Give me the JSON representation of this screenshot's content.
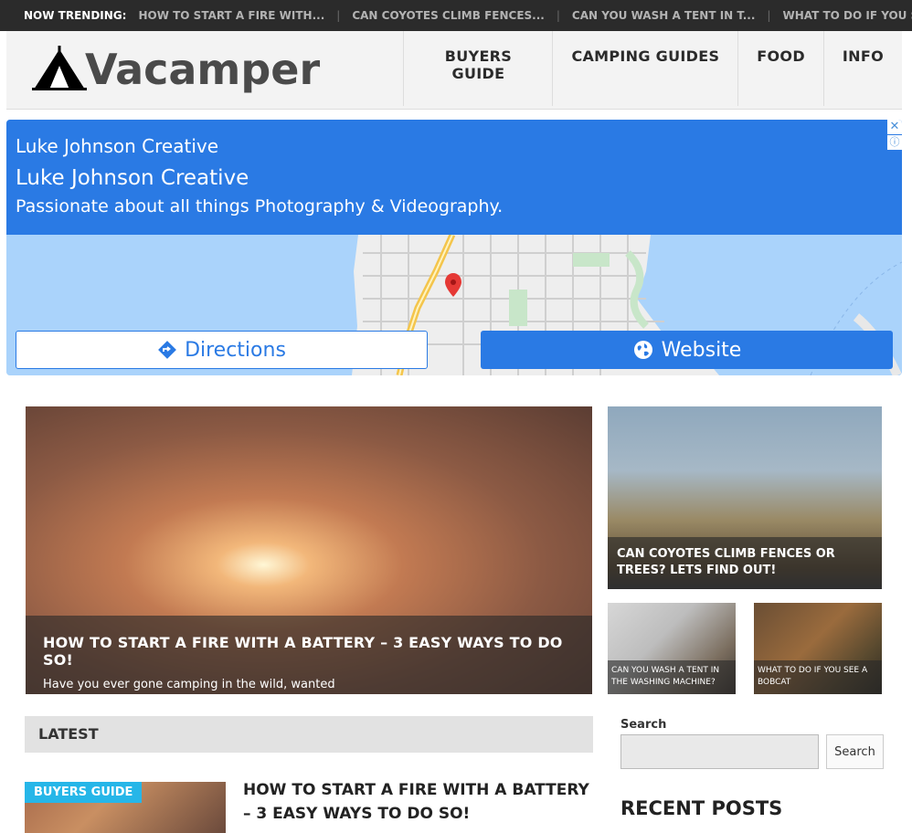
{
  "trending": {
    "label": "NOW TRENDING:",
    "items": [
      "HOW TO START A FIRE WITH...",
      "CAN COYOTES CLIMB FENCES...",
      "CAN YOU WASH A TENT IN T...",
      "WHAT TO DO IF YOU SEE A ..."
    ]
  },
  "site": {
    "logo_text": "Vacamper"
  },
  "nav": {
    "items": [
      "BUYERS GUIDE",
      "CAMPING GUIDES",
      "FOOD",
      "INFO"
    ]
  },
  "ad": {
    "line1": "Luke Johnson Creative",
    "line2": "Luke Johnson Creative",
    "line3": "Passionate about all things Photography & Videography.",
    "close": "✕",
    "info": "ⓘ",
    "directions_label": "Directions",
    "website_label": "Website"
  },
  "featured": {
    "main_title": "HOW TO START A FIRE WITH A BATTERY – 3 EASY WAYS TO DO SO!",
    "main_excerpt": "Have you ever gone camping in the wild, wanted",
    "coyote_title": "CAN COYOTES CLIMB FENCES OR TREES? LETS FIND OUT!",
    "wash_title": "CAN YOU WASH A TENT IN THE WASHING MACHINE?",
    "bobcat_title": "WHAT TO DO IF YOU SEE A BOBCAT"
  },
  "latest": {
    "heading": "LATEST",
    "post_badge": "BUYERS GUIDE",
    "post_title": "HOW TO START A FIRE WITH A BATTERY – 3 EASY WAYS TO DO SO!"
  },
  "sidebar": {
    "search_label": "Search",
    "search_placeholder": "",
    "search_button": "Search",
    "recent_heading": "RECENT POSTS"
  },
  "colors": {
    "ad_blue": "#2a7ae4",
    "badge_blue": "#26b6e8",
    "trending_bg": "#2b2b2b"
  },
  "icons": [
    "tent-logo-icon",
    "directions-icon",
    "globe-icon",
    "map-pin-icon",
    "close-icon",
    "info-icon"
  ]
}
